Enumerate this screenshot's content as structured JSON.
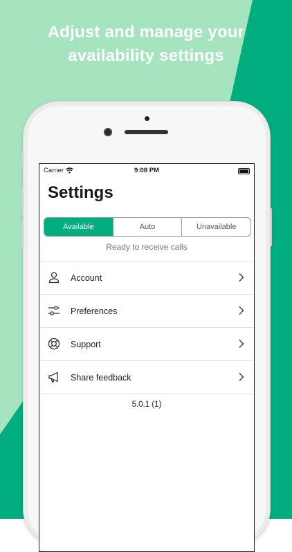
{
  "promo": {
    "headline_line1": "Adjust and manage your",
    "headline_line2": "availability settings"
  },
  "status_bar": {
    "carrier": "Carrier",
    "time": "9:08 PM"
  },
  "page": {
    "title": "Settings"
  },
  "availability": {
    "options": [
      "Available",
      "Auto",
      "Unavailable"
    ],
    "selected": "Available",
    "status_text": "Ready to receive calls"
  },
  "menu": {
    "items": [
      {
        "label": "Account",
        "icon": "person-icon"
      },
      {
        "label": "Preferences",
        "icon": "sliders-icon"
      },
      {
        "label": "Support",
        "icon": "lifebuoy-icon"
      },
      {
        "label": "Share feedback",
        "icon": "megaphone-icon"
      }
    ]
  },
  "footer": {
    "version": "5.0.1 (1)"
  },
  "colors": {
    "accent": "#02ad80",
    "light_green": "#a6e4c0"
  }
}
